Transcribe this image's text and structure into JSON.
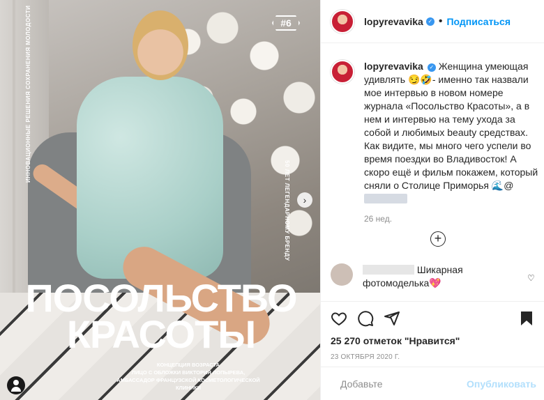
{
  "photo": {
    "badge": "#6",
    "side_text_left": "ИННОВАЦИОННЫЕ РЕШЕНИЯ СОХРАНЕНИЯ МОЛОДОСТИ",
    "side_text_right": "50 ЛЕТ ЛЕГЕНДАРНОМУ БРЕНДУ",
    "title_line1": "ПОСОЛЬСТВО",
    "title_line2": "КРАСОТЫ",
    "caption_line1": "КОНЦЕПЦИЯ ВОЗРАСТА",
    "caption_line2": "ЛИЦО С ОБЛОЖКИ ВИКТОРИЯ ЛОПЫРЕВА,",
    "caption_line3": "АМБАССАДОР ФРАНЦУЗСКОЙ КОСМЕТОЛОГИЧЕСКОЙ КЛИНИКИ",
    "next_icon": "chevron-right"
  },
  "header": {
    "username": "lopyrevavika",
    "separator": "•",
    "follow_label": "Подписаться"
  },
  "caption": {
    "username": "lopyrevavika",
    "text": "Женщина умеющая удивлять 😏🤣- именно так назвали мое интервью в новом номере журнала «Посольство Красоты», а в нем и интервью на тему ухода за собой и любимых beauty средствах. Как видите, мы много чего успели во время поездки во Владивосток! А скоро ещё и фильм покажем, который сняли о Столице Приморья 🌊@",
    "time_ago": "26 нед."
  },
  "comment": {
    "text": "Шикарная фотомоделька💖"
  },
  "stats": {
    "likes": "25 270 отметок \"Нравится\"",
    "date": "23 ОКТЯБРЯ 2020 Г."
  },
  "add_comment": {
    "placeholder": "Добавьте",
    "publish_label": "Опубликовать"
  },
  "colors": {
    "accent": "#0095f6",
    "publish_disabled": "#b2dffc",
    "verified": "#3897f0"
  }
}
